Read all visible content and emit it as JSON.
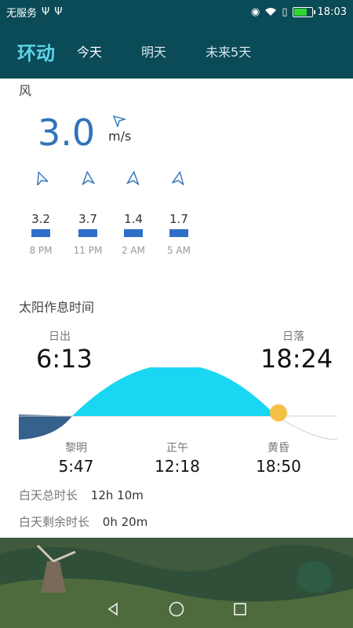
{
  "status": {
    "carrier": "无服务",
    "time": "18:03",
    "icons": [
      "usb-icon",
      "usb-icon",
      "eye-icon",
      "wifi-icon",
      "sim-alert-icon",
      "battery-icon"
    ]
  },
  "appbar": {
    "title": "环动",
    "tabs": [
      {
        "label": "今天",
        "active": true
      },
      {
        "label": "明天",
        "active": false
      },
      {
        "label": "未来5天",
        "active": false
      }
    ]
  },
  "wind": {
    "label": "风",
    "speed": "3.0",
    "unit": "m/s",
    "forecast": [
      {
        "value": "3.2",
        "time": "8 PM"
      },
      {
        "value": "3.7",
        "time": "11 PM"
      },
      {
        "value": "1.4",
        "time": "2 AM"
      },
      {
        "value": "1.7",
        "time": "5 AM"
      }
    ]
  },
  "sun": {
    "title": "太阳作息时间",
    "sunrise_label": "日出",
    "sunrise": "6:13",
    "sunset_label": "日落",
    "sunset": "18:24",
    "dawn_label": "黎明",
    "dawn": "5:47",
    "noon_label": "正午",
    "noon": "12:18",
    "dusk_label": "黄昏",
    "dusk": "18:50",
    "day_length_label": "白天总时长",
    "day_length": "12h 10m",
    "day_remaining_label": "白天剩余时长",
    "day_remaining": "0h 20m",
    "colors": {
      "day": "#19d7f2",
      "night": "#36618c",
      "sun": "#f5c046"
    }
  }
}
